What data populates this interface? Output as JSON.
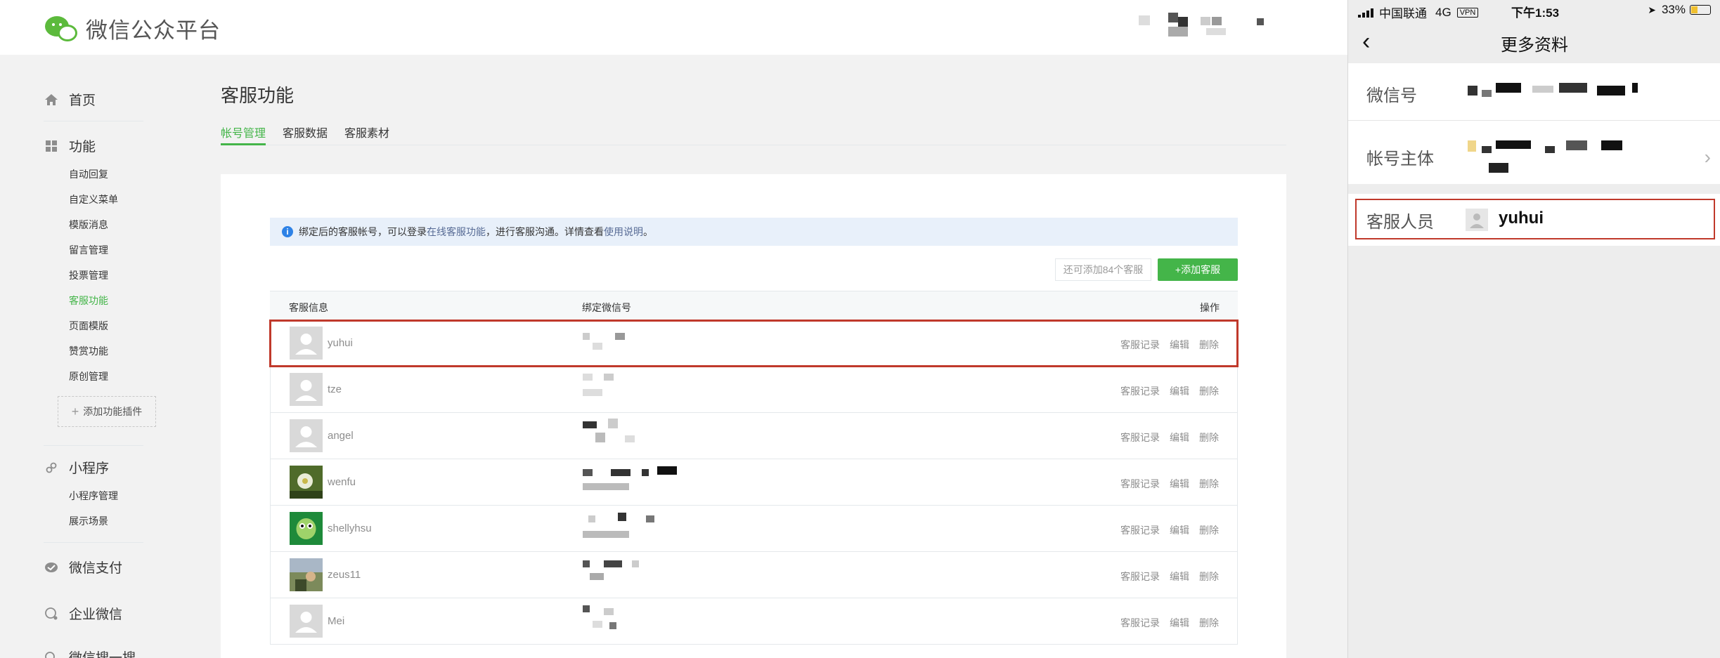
{
  "header": {
    "logo_text": "微信公众平台"
  },
  "sidebar": {
    "home": "首页",
    "features": "功能",
    "feature_items": [
      "自动回复",
      "自定义菜单",
      "模版消息",
      "留言管理",
      "投票管理",
      "客服功能",
      "页面模版",
      "赞赏功能",
      "原创管理"
    ],
    "add_plugin": "添加功能插件",
    "miniprogram": "小程序",
    "miniprogram_items": [
      "小程序管理",
      "展示场景"
    ],
    "pay": "微信支付",
    "work_wechat": "企业微信",
    "more": "微信搜一搜"
  },
  "main": {
    "title": "客服功能",
    "tabs": [
      "帐号管理",
      "客服数据",
      "客服素材"
    ],
    "notice": {
      "text_before": "绑定后的客服帐号，可以登录",
      "link1": "在线客服功能",
      "text_middle": "，进行客服沟通。详情查看",
      "link2": "使用说明",
      "text_after": "。"
    },
    "quota": "还可添加84个客服",
    "add_button": "+添加客服",
    "table": {
      "columns": [
        "客服信息",
        "绑定微信号",
        "操作"
      ],
      "ops": [
        "客服记录",
        "编辑",
        "删除"
      ],
      "rows": [
        {
          "name": "yuhui"
        },
        {
          "name": "tze"
        },
        {
          "name": "angel"
        },
        {
          "name": "wenfu"
        },
        {
          "name": "shellyhsu"
        },
        {
          "name": "zeus11"
        },
        {
          "name": "Mei"
        }
      ]
    }
  },
  "phone": {
    "carrier": "中国联通",
    "network": "4G",
    "vpn": "VPN",
    "time": "下午1:53",
    "battery": "33%",
    "battery_level": 0.33,
    "nav_title": "更多资料",
    "fields": {
      "wechat_id": "微信号",
      "account_owner": "帐号主体",
      "staff": "客服人员",
      "staff_name": "yuhui"
    }
  },
  "colors": {
    "accent": "#44b549",
    "highlight": "#c0392b",
    "link": "#576b95"
  }
}
